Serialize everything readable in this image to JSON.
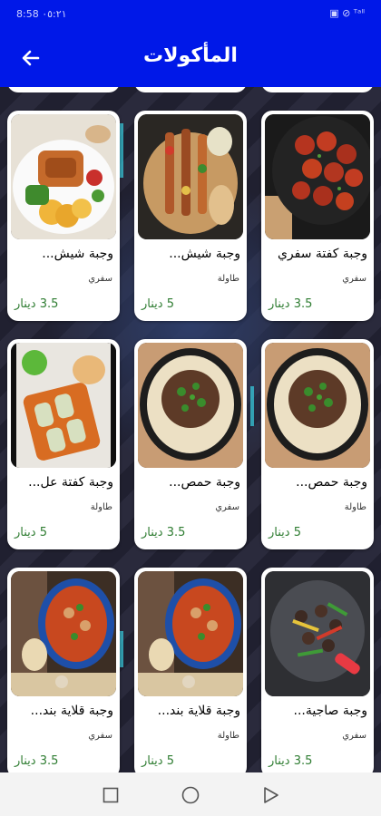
{
  "status": {
    "time": "8:58 ٠٥:٢١",
    "icons": "▣ ⊘ ᵀᵃˡˡ"
  },
  "header": {
    "title": "المأكولات",
    "back_icon": "arrow-left-icon"
  },
  "items": [
    {
      "name": "وجبة شيش...",
      "category": "سفري",
      "price": "3.5 دينار",
      "image": "shish-platter"
    },
    {
      "name": "وجبة شيش...",
      "category": "طاولة",
      "price": "5 دينار",
      "image": "shish-board"
    },
    {
      "name": "وجبة كفتة سفري",
      "category": "سفري",
      "price": "3.5 دينار",
      "image": "kofta-tomato"
    },
    {
      "name": "وجبة كفتة عل...",
      "category": "طاولة",
      "price": "5 دينار",
      "image": "kofta-tray"
    },
    {
      "name": "وجبة حمص...",
      "category": "سفري",
      "price": "3.5 دينار",
      "image": "hummus-meat"
    },
    {
      "name": "وجبة حمص...",
      "category": "طاولة",
      "price": "5 دينار",
      "image": "hummus-meat"
    },
    {
      "name": "وجبة قلاية بند...",
      "category": "سفري",
      "price": "3.5 دينار",
      "image": "tomato-stew"
    },
    {
      "name": "وجبة قلاية بند...",
      "category": "طاولة",
      "price": "5 دينار",
      "image": "tomato-stew"
    },
    {
      "name": "وجبة صاجية...",
      "category": "سفري",
      "price": "3.5 دينار",
      "image": "saj-stirfry"
    }
  ],
  "nav": {
    "recent": "square-icon",
    "home": "circle-icon",
    "back": "triangle-icon"
  }
}
